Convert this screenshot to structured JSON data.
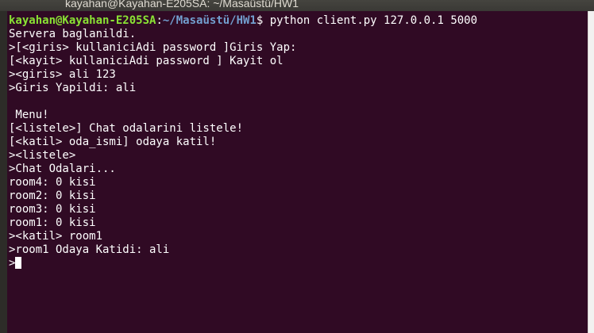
{
  "window": {
    "title": "kayahan@Kayahan-E205SA: ~/Masaüstü/HW1"
  },
  "prompt": {
    "user_host": "kayahan@Kayahan-E205SA",
    "sep": ":",
    "path": "~/Masaüstü/HW1",
    "symbol": "$ ",
    "command": "python client.py 127.0.0.1 5000"
  },
  "output": {
    "lines": [
      "Servera baglanildi.",
      ">[<giris> kullaniciAdi password ]Giris Yap:",
      "[<kayit> kullaniciAdi password ] Kayit ol",
      "><giris> ali 123",
      ">Giris Yapildi: ali",
      "",
      " Menu!",
      "[<listele>] Chat odalarini listele!",
      "[<katil> oda_ismi] odaya katil!",
      "><listele>",
      ">Chat Odalari...",
      "room4: 0 kisi",
      "room2: 0 kisi",
      "room3: 0 kisi",
      "room1: 0 kisi",
      "><katil> room1",
      ">room1 Odaya Katidi: ali"
    ],
    "current_prompt": ">"
  }
}
